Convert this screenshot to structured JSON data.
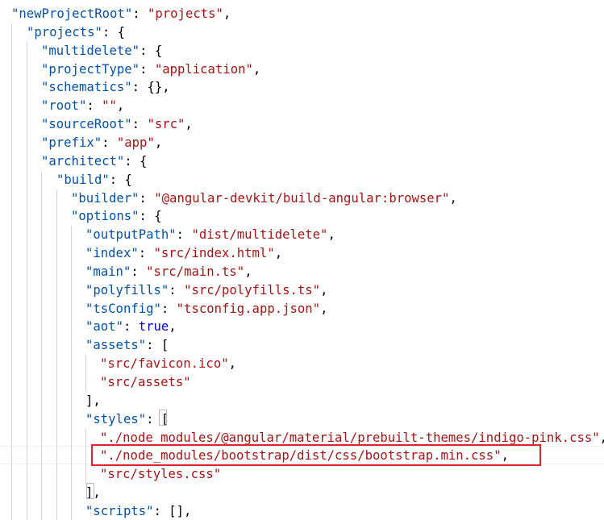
{
  "code": {
    "lines": [
      {
        "tokens": [
          {
            "t": "\"newProjectRoot\"",
            "c": "k"
          },
          {
            "t": ": ",
            "c": "p"
          },
          {
            "t": "\"projects\"",
            "c": "s"
          },
          {
            "t": ",",
            "c": "p"
          }
        ]
      },
      {
        "tokens": [
          {
            "t": "\"projects\"",
            "c": "k"
          },
          {
            "t": ": {",
            "c": "p"
          }
        ]
      },
      {
        "tokens": [
          {
            "t": "\"multidelete\"",
            "c": "k"
          },
          {
            "t": ": {",
            "c": "p"
          }
        ]
      },
      {
        "tokens": [
          {
            "t": "\"projectType\"",
            "c": "k"
          },
          {
            "t": ": ",
            "c": "p"
          },
          {
            "t": "\"application\"",
            "c": "s"
          },
          {
            "t": ",",
            "c": "p"
          }
        ]
      },
      {
        "tokens": [
          {
            "t": "\"schematics\"",
            "c": "k"
          },
          {
            "t": ": {},",
            "c": "p"
          }
        ]
      },
      {
        "tokens": [
          {
            "t": "\"root\"",
            "c": "k"
          },
          {
            "t": ": ",
            "c": "p"
          },
          {
            "t": "\"\"",
            "c": "s"
          },
          {
            "t": ",",
            "c": "p"
          }
        ]
      },
      {
        "tokens": [
          {
            "t": "\"sourceRoot\"",
            "c": "k"
          },
          {
            "t": ": ",
            "c": "p"
          },
          {
            "t": "\"src\"",
            "c": "s"
          },
          {
            "t": ",",
            "c": "p"
          }
        ]
      },
      {
        "tokens": [
          {
            "t": "\"prefix\"",
            "c": "k"
          },
          {
            "t": ": ",
            "c": "p"
          },
          {
            "t": "\"app\"",
            "c": "s"
          },
          {
            "t": ",",
            "c": "p"
          }
        ]
      },
      {
        "tokens": [
          {
            "t": "\"architect\"",
            "c": "k"
          },
          {
            "t": ": {",
            "c": "p"
          }
        ]
      },
      {
        "tokens": [
          {
            "t": "\"build\"",
            "c": "k"
          },
          {
            "t": ": {",
            "c": "p"
          }
        ]
      },
      {
        "tokens": [
          {
            "t": "\"builder\"",
            "c": "k"
          },
          {
            "t": ": ",
            "c": "p"
          },
          {
            "t": "\"@angular-devkit/build-angular:browser\"",
            "c": "s"
          },
          {
            "t": ",",
            "c": "p"
          }
        ]
      },
      {
        "tokens": [
          {
            "t": "\"options\"",
            "c": "k"
          },
          {
            "t": ": {",
            "c": "p"
          }
        ]
      },
      {
        "tokens": [
          {
            "t": "\"outputPath\"",
            "c": "k"
          },
          {
            "t": ": ",
            "c": "p"
          },
          {
            "t": "\"dist/multidelete\"",
            "c": "s"
          },
          {
            "t": ",",
            "c": "p"
          }
        ]
      },
      {
        "tokens": [
          {
            "t": "\"index\"",
            "c": "k"
          },
          {
            "t": ": ",
            "c": "p"
          },
          {
            "t": "\"src/index.html\"",
            "c": "s"
          },
          {
            "t": ",",
            "c": "p"
          }
        ]
      },
      {
        "tokens": [
          {
            "t": "\"main\"",
            "c": "k"
          },
          {
            "t": ": ",
            "c": "p"
          },
          {
            "t": "\"src/main.ts\"",
            "c": "s"
          },
          {
            "t": ",",
            "c": "p"
          }
        ]
      },
      {
        "tokens": [
          {
            "t": "\"polyfills\"",
            "c": "k"
          },
          {
            "t": ": ",
            "c": "p"
          },
          {
            "t": "\"src/polyfills.ts\"",
            "c": "s"
          },
          {
            "t": ",",
            "c": "p"
          }
        ]
      },
      {
        "tokens": [
          {
            "t": "\"tsConfig\"",
            "c": "k"
          },
          {
            "t": ": ",
            "c": "p"
          },
          {
            "t": "\"tsconfig.app.json\"",
            "c": "s"
          },
          {
            "t": ",",
            "c": "p"
          }
        ]
      },
      {
        "tokens": [
          {
            "t": "\"aot\"",
            "c": "k"
          },
          {
            "t": ": ",
            "c": "p"
          },
          {
            "t": "true",
            "c": "b"
          },
          {
            "t": ",",
            "c": "p"
          }
        ]
      },
      {
        "tokens": [
          {
            "t": "\"assets\"",
            "c": "k"
          },
          {
            "t": ": [",
            "c": "p"
          }
        ]
      },
      {
        "tokens": [
          {
            "t": "\"src/favicon.ico\"",
            "c": "s"
          },
          {
            "t": ",",
            "c": "p"
          }
        ]
      },
      {
        "tokens": [
          {
            "t": "\"src/assets\"",
            "c": "s"
          }
        ]
      },
      {
        "tokens": [
          {
            "t": "],",
            "c": "p"
          }
        ]
      },
      {
        "tokens": [
          {
            "t": "\"styles\"",
            "c": "k"
          },
          {
            "t": ": [",
            "c": "p"
          }
        ]
      },
      {
        "tokens": [
          {
            "t": "\"./node_modules/@angular/material/prebuilt-themes/indigo-pink.css\"",
            "c": "s"
          },
          {
            "t": ",",
            "c": "p"
          }
        ]
      },
      {
        "tokens": [
          {
            "t": "\"./node_modules/bootstrap/dist/css/bootstrap.min.css\"",
            "c": "s"
          },
          {
            "t": ",",
            "c": "p"
          }
        ]
      },
      {
        "tokens": [
          {
            "t": "\"src/styles.css\"",
            "c": "s"
          }
        ]
      },
      {
        "tokens": [
          {
            "t": "],",
            "c": "p"
          }
        ]
      },
      {
        "tokens": [
          {
            "t": "\"scripts\"",
            "c": "k"
          },
          {
            "t": ": [],",
            "c": "p"
          }
        ]
      }
    ]
  },
  "colors": {
    "property_key": "#0451a5",
    "string_value": "#a31515",
    "boolean_value": "#0000ff",
    "punctuation": "#000000",
    "highlight_border": "#e0262d"
  }
}
